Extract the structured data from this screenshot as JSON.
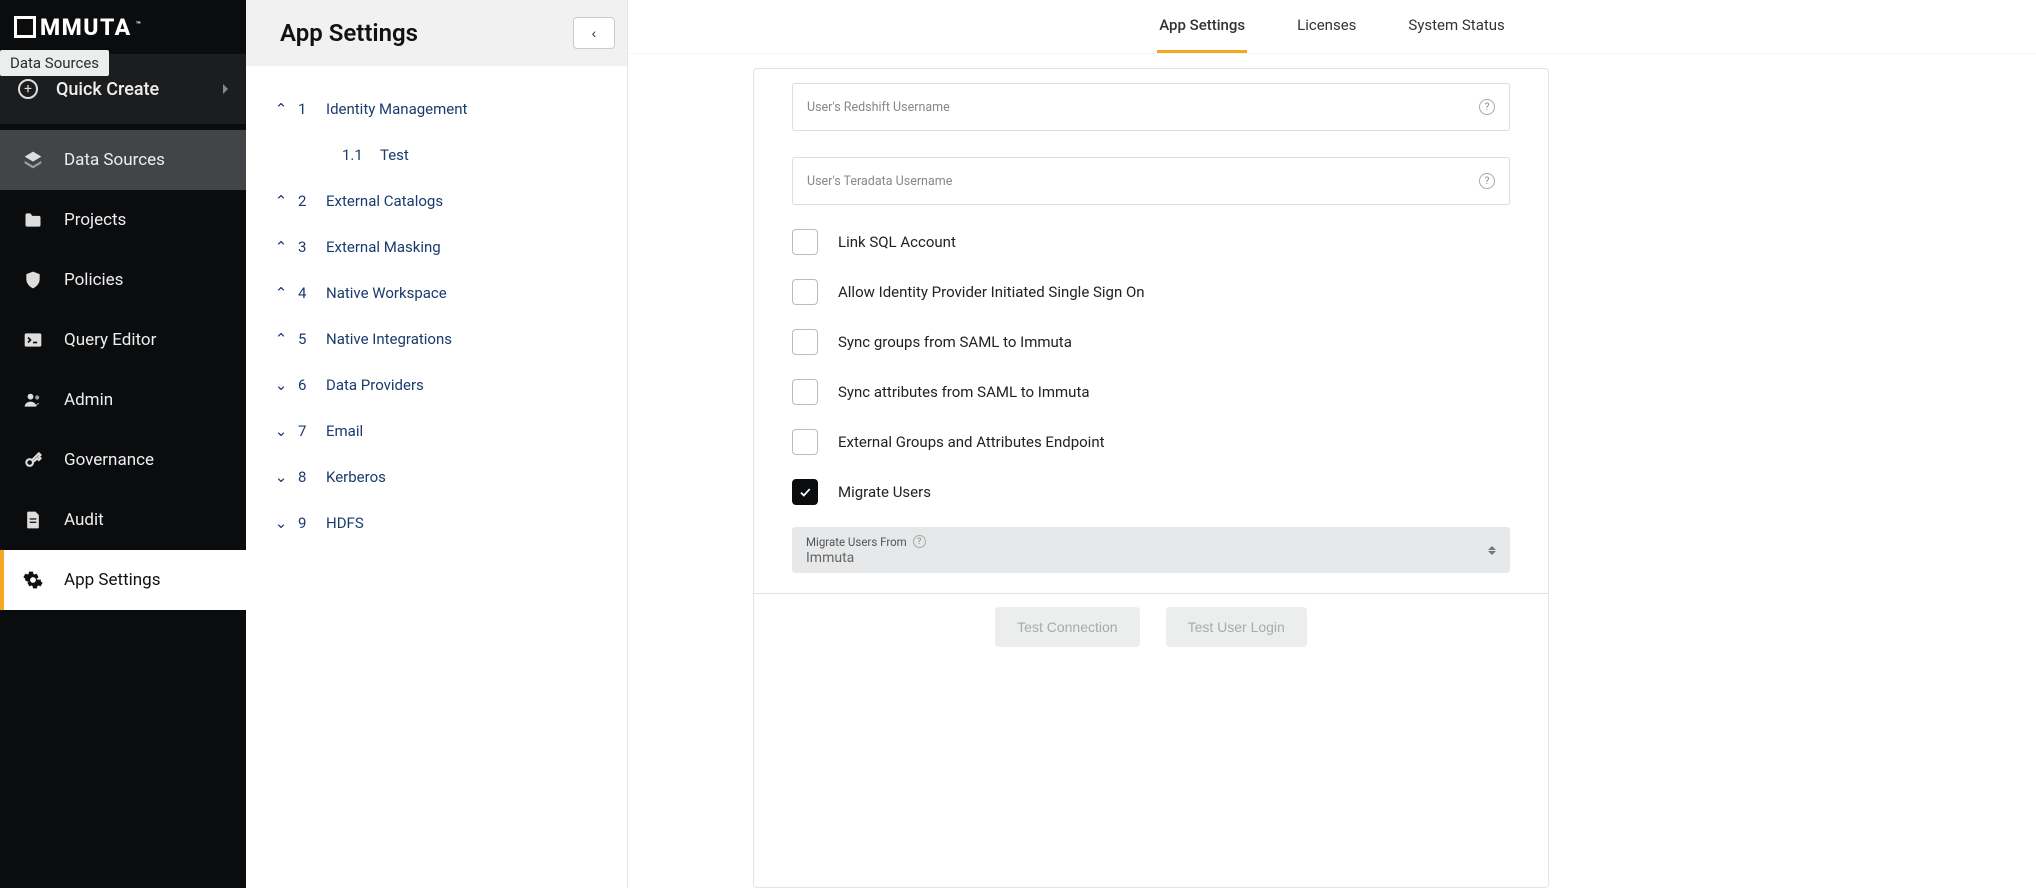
{
  "tooltip": {
    "text": "Data Sources"
  },
  "logo": {
    "text": "MMUTA",
    "tm": "™"
  },
  "quickCreate": {
    "label": "Quick Create"
  },
  "sidebar": {
    "items": [
      {
        "label": "Data Sources"
      },
      {
        "label": "Projects"
      },
      {
        "label": "Policies"
      },
      {
        "label": "Query Editor"
      },
      {
        "label": "Admin"
      },
      {
        "label": "Governance"
      },
      {
        "label": "Audit"
      },
      {
        "label": "App Settings"
      }
    ]
  },
  "settingsNav": {
    "title": "App Settings",
    "collapseGlyph": "‹",
    "items": [
      {
        "num": "1",
        "label": "Identity Management",
        "expanded": true
      },
      {
        "num": "2",
        "label": "External Catalogs",
        "expanded": true
      },
      {
        "num": "3",
        "label": "External Masking",
        "expanded": true
      },
      {
        "num": "4",
        "label": "Native Workspace",
        "expanded": true
      },
      {
        "num": "5",
        "label": "Native Integrations",
        "expanded": true
      },
      {
        "num": "6",
        "label": "Data Providers",
        "expanded": false
      },
      {
        "num": "7",
        "label": "Email",
        "expanded": false
      },
      {
        "num": "8",
        "label": "Kerberos",
        "expanded": false
      },
      {
        "num": "9",
        "label": "HDFS",
        "expanded": false
      }
    ],
    "sub": {
      "num": "1.1",
      "label": "Test"
    }
  },
  "tabs": {
    "app": "App Settings",
    "licenses": "Licenses",
    "status": "System Status"
  },
  "form": {
    "redshift": "User's Redshift Username",
    "teradata": "User's Teradata Username",
    "linkSql": "Link SQL Account",
    "idpSso": "Allow Identity Provider Initiated Single Sign On",
    "syncGroups": "Sync groups from SAML to Immuta",
    "syncAttrs": "Sync attributes from SAML to Immuta",
    "extGroups": "External Groups and Attributes Endpoint",
    "migrate": "Migrate Users",
    "migrateFromLabel": "Migrate Users From",
    "migrateFromValue": "Immuta"
  },
  "actions": {
    "testConnection": "Test Connection",
    "testUserLogin": "Test User Login"
  }
}
